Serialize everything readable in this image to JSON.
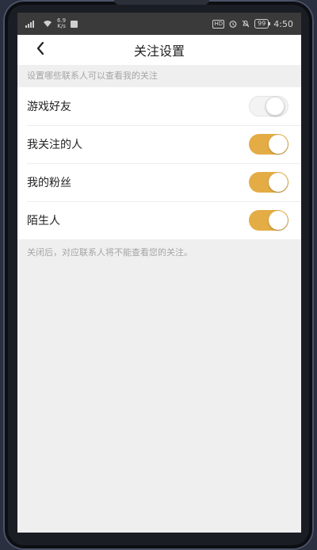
{
  "status_bar": {
    "speed_value": "6.9",
    "speed_unit": "K/s",
    "battery": "99",
    "time": "4:50",
    "hd": "HD"
  },
  "nav": {
    "title": "关注设置",
    "back_icon": "chevron-left-icon"
  },
  "section_hint": "设置哪些联系人可以查看我的关注",
  "settings": [
    {
      "label": "游戏好友",
      "enabled": false
    },
    {
      "label": "我关注的人",
      "enabled": true
    },
    {
      "label": "我的粉丝",
      "enabled": true
    },
    {
      "label": "陌生人",
      "enabled": true
    }
  ],
  "footnote": "关闭后，对应联系人将不能查看您的关注。",
  "colors": {
    "toggle_on": "#e4ac44",
    "toggle_off": "#f3f3f3",
    "background": "#efefef"
  }
}
